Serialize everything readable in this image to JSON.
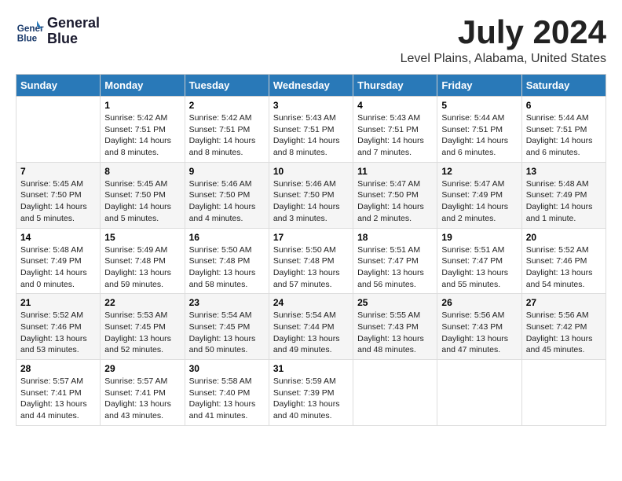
{
  "header": {
    "logo_line1": "General",
    "logo_line2": "Blue",
    "month": "July 2024",
    "location": "Level Plains, Alabama, United States"
  },
  "days_of_week": [
    "Sunday",
    "Monday",
    "Tuesday",
    "Wednesday",
    "Thursday",
    "Friday",
    "Saturday"
  ],
  "weeks": [
    [
      {
        "day": "",
        "info": ""
      },
      {
        "day": "1",
        "info": "Sunrise: 5:42 AM\nSunset: 7:51 PM\nDaylight: 14 hours\nand 8 minutes."
      },
      {
        "day": "2",
        "info": "Sunrise: 5:42 AM\nSunset: 7:51 PM\nDaylight: 14 hours\nand 8 minutes."
      },
      {
        "day": "3",
        "info": "Sunrise: 5:43 AM\nSunset: 7:51 PM\nDaylight: 14 hours\nand 8 minutes."
      },
      {
        "day": "4",
        "info": "Sunrise: 5:43 AM\nSunset: 7:51 PM\nDaylight: 14 hours\nand 7 minutes."
      },
      {
        "day": "5",
        "info": "Sunrise: 5:44 AM\nSunset: 7:51 PM\nDaylight: 14 hours\nand 6 minutes."
      },
      {
        "day": "6",
        "info": "Sunrise: 5:44 AM\nSunset: 7:51 PM\nDaylight: 14 hours\nand 6 minutes."
      }
    ],
    [
      {
        "day": "7",
        "info": "Sunrise: 5:45 AM\nSunset: 7:50 PM\nDaylight: 14 hours\nand 5 minutes."
      },
      {
        "day": "8",
        "info": "Sunrise: 5:45 AM\nSunset: 7:50 PM\nDaylight: 14 hours\nand 5 minutes."
      },
      {
        "day": "9",
        "info": "Sunrise: 5:46 AM\nSunset: 7:50 PM\nDaylight: 14 hours\nand 4 minutes."
      },
      {
        "day": "10",
        "info": "Sunrise: 5:46 AM\nSunset: 7:50 PM\nDaylight: 14 hours\nand 3 minutes."
      },
      {
        "day": "11",
        "info": "Sunrise: 5:47 AM\nSunset: 7:50 PM\nDaylight: 14 hours\nand 2 minutes."
      },
      {
        "day": "12",
        "info": "Sunrise: 5:47 AM\nSunset: 7:49 PM\nDaylight: 14 hours\nand 2 minutes."
      },
      {
        "day": "13",
        "info": "Sunrise: 5:48 AM\nSunset: 7:49 PM\nDaylight: 14 hours\nand 1 minute."
      }
    ],
    [
      {
        "day": "14",
        "info": "Sunrise: 5:48 AM\nSunset: 7:49 PM\nDaylight: 14 hours\nand 0 minutes."
      },
      {
        "day": "15",
        "info": "Sunrise: 5:49 AM\nSunset: 7:48 PM\nDaylight: 13 hours\nand 59 minutes."
      },
      {
        "day": "16",
        "info": "Sunrise: 5:50 AM\nSunset: 7:48 PM\nDaylight: 13 hours\nand 58 minutes."
      },
      {
        "day": "17",
        "info": "Sunrise: 5:50 AM\nSunset: 7:48 PM\nDaylight: 13 hours\nand 57 minutes."
      },
      {
        "day": "18",
        "info": "Sunrise: 5:51 AM\nSunset: 7:47 PM\nDaylight: 13 hours\nand 56 minutes."
      },
      {
        "day": "19",
        "info": "Sunrise: 5:51 AM\nSunset: 7:47 PM\nDaylight: 13 hours\nand 55 minutes."
      },
      {
        "day": "20",
        "info": "Sunrise: 5:52 AM\nSunset: 7:46 PM\nDaylight: 13 hours\nand 54 minutes."
      }
    ],
    [
      {
        "day": "21",
        "info": "Sunrise: 5:52 AM\nSunset: 7:46 PM\nDaylight: 13 hours\nand 53 minutes."
      },
      {
        "day": "22",
        "info": "Sunrise: 5:53 AM\nSunset: 7:45 PM\nDaylight: 13 hours\nand 52 minutes."
      },
      {
        "day": "23",
        "info": "Sunrise: 5:54 AM\nSunset: 7:45 PM\nDaylight: 13 hours\nand 50 minutes."
      },
      {
        "day": "24",
        "info": "Sunrise: 5:54 AM\nSunset: 7:44 PM\nDaylight: 13 hours\nand 49 minutes."
      },
      {
        "day": "25",
        "info": "Sunrise: 5:55 AM\nSunset: 7:43 PM\nDaylight: 13 hours\nand 48 minutes."
      },
      {
        "day": "26",
        "info": "Sunrise: 5:56 AM\nSunset: 7:43 PM\nDaylight: 13 hours\nand 47 minutes."
      },
      {
        "day": "27",
        "info": "Sunrise: 5:56 AM\nSunset: 7:42 PM\nDaylight: 13 hours\nand 45 minutes."
      }
    ],
    [
      {
        "day": "28",
        "info": "Sunrise: 5:57 AM\nSunset: 7:41 PM\nDaylight: 13 hours\nand 44 minutes."
      },
      {
        "day": "29",
        "info": "Sunrise: 5:57 AM\nSunset: 7:41 PM\nDaylight: 13 hours\nand 43 minutes."
      },
      {
        "day": "30",
        "info": "Sunrise: 5:58 AM\nSunset: 7:40 PM\nDaylight: 13 hours\nand 41 minutes."
      },
      {
        "day": "31",
        "info": "Sunrise: 5:59 AM\nSunset: 7:39 PM\nDaylight: 13 hours\nand 40 minutes."
      },
      {
        "day": "",
        "info": ""
      },
      {
        "day": "",
        "info": ""
      },
      {
        "day": "",
        "info": ""
      }
    ]
  ]
}
